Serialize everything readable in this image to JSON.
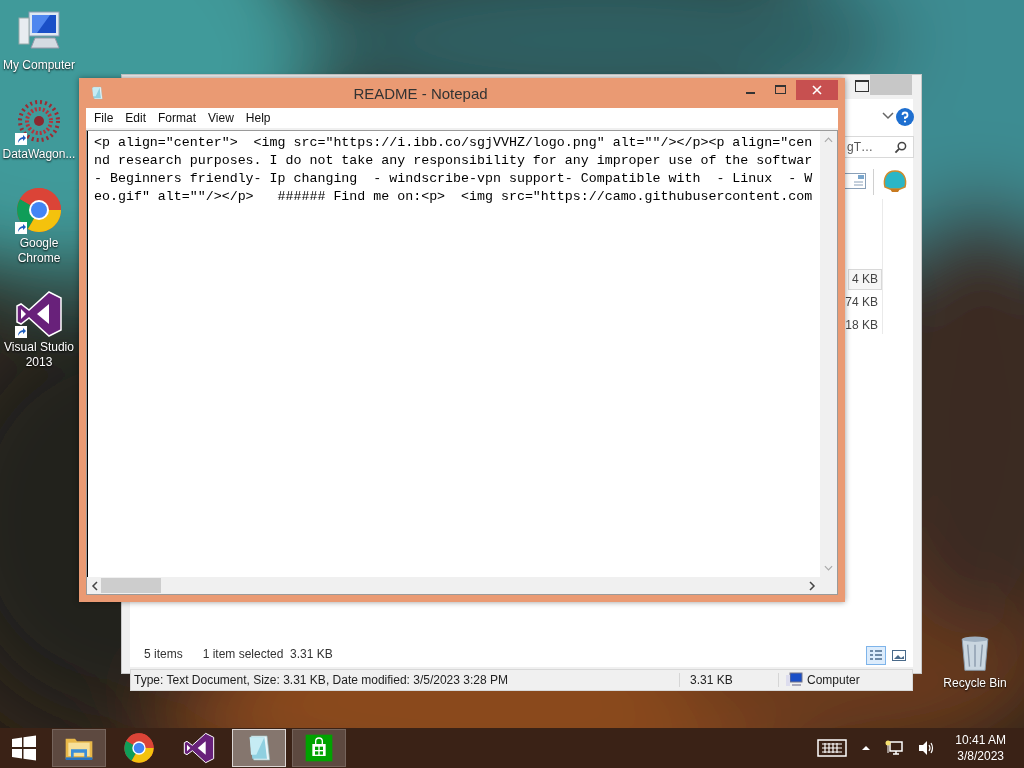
{
  "desktop_icons": [
    {
      "kind": "computer",
      "label": "My Computer",
      "shortcut": false
    },
    {
      "kind": "datawagon",
      "label": "DataWagon...",
      "shortcut": true
    },
    {
      "kind": "chrome",
      "label": "Google Chrome",
      "shortcut": true
    },
    {
      "kind": "visualstudio",
      "label": "Visual Studio 2013",
      "shortcut": true
    }
  ],
  "recycle_bin": {
    "label": "Recycle Bin"
  },
  "explorer": {
    "search_text": "gT…",
    "sizes": [
      {
        "text": "4 KB",
        "selected": true
      },
      {
        "text": "74 KB",
        "selected": false
      },
      {
        "text": "18 KB",
        "selected": false
      }
    ],
    "item_count": "5 items",
    "selection_info": "1 item selected  3.31 KB",
    "view_buttons": [
      {
        "kind": "details",
        "selected": true
      },
      {
        "kind": "thumbnails",
        "selected": false
      }
    ],
    "status_text": "Type: Text Document, Size: 3.31 KB, Date modified: 3/5/2023 3:28 PM",
    "status_size": "3.31 KB",
    "status_location": "Computer"
  },
  "notepad": {
    "title": "README - Notepad",
    "menu": [
      "File",
      "Edit",
      "Format",
      "View",
      "Help"
    ],
    "lines": [
      "<p align=\"center\">  <img src=\"https://i.ibb.co/sgjVVHZ/logo.png\" alt=\"\"/></p><p align=\"cen",
      "nd research purposes. I do not take any responsibility for any improper use of the softwar",
      "- Beginners friendly- Ip changing  - windscribe-vpn support- Compatible with  - Linux  - W",
      "eo.gif\" alt=\"\"/></p>   ###### Find me on:<p>  <img src=\"https://camo.githubusercontent.com"
    ]
  },
  "taskbar": {
    "apps": [
      {
        "kind": "explorer",
        "running": true,
        "selected": false
      },
      {
        "kind": "chrome",
        "running": false,
        "selected": false
      },
      {
        "kind": "visualstudio",
        "running": false,
        "selected": false
      },
      {
        "kind": "notepad",
        "running": true,
        "selected": true
      },
      {
        "kind": "store",
        "running": true,
        "selected": false
      }
    ],
    "time": "10:41 AM",
    "date": "3/8/2023"
  }
}
